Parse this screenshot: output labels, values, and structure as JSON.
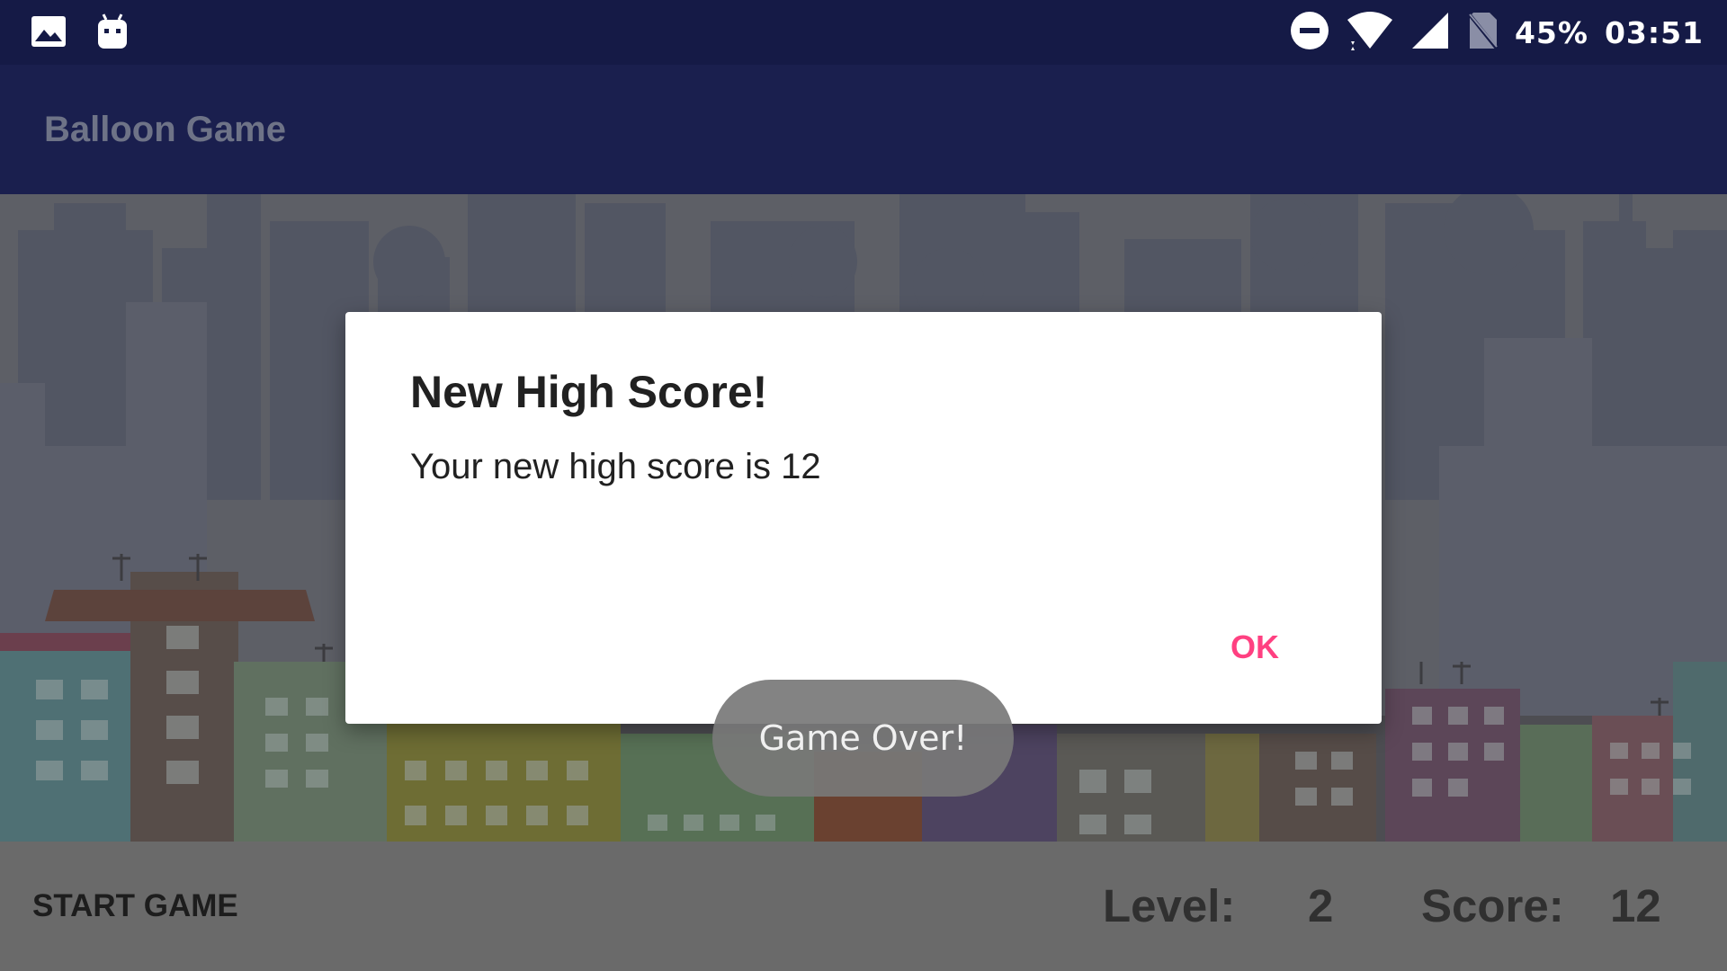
{
  "status_bar": {
    "battery": "45%",
    "time": "03:51",
    "left_icons": [
      "image-icon",
      "android-debug-icon"
    ],
    "right_icons": [
      "do-not-disturb-icon",
      "wifi-icon",
      "signal-icon",
      "no-sim-icon"
    ]
  },
  "app_bar": {
    "title": "Balloon Game"
  },
  "dialog": {
    "title": "New High Score!",
    "message": "Your new high score is 12",
    "ok_label": "OK"
  },
  "toast": {
    "text": "Game Over!"
  },
  "bottom_bar": {
    "start_label": "START GAME",
    "level_label": "Level:",
    "level_value": "2",
    "score_label": "Score:",
    "score_value": "12"
  },
  "colors": {
    "status_bar_bg": "#151a46",
    "app_bar_bg": "#1a1f4e",
    "accent": "#ff4081",
    "dim_overlay": "#5d5f66"
  }
}
